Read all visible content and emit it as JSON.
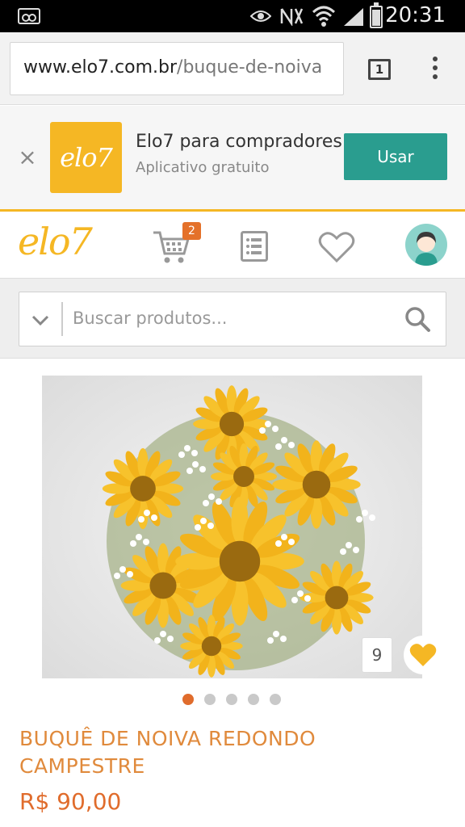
{
  "status_bar": {
    "time": "20:31",
    "icons": [
      "voicemail-icon",
      "eye-icon",
      "nfc-icon",
      "wifi-icon",
      "signal-icon",
      "battery-icon"
    ]
  },
  "browser": {
    "url_host": "www.elo7.com.br",
    "url_path": "/buque-de-noiva",
    "tab_count": "1"
  },
  "app_banner": {
    "logo_text": "elo7",
    "title": "Elo7 para compradores",
    "subtitle": "Aplicativo gratuito",
    "button_label": "Usar"
  },
  "header": {
    "logo_text": "elo7",
    "cart_count": "2"
  },
  "search": {
    "placeholder": "Buscar produtos..."
  },
  "product": {
    "favorites_count": "9",
    "title": "BUQUÊ DE NOIVA REDONDO CAMPESTRE",
    "price": "R$ 90,00",
    "carousel_total": 5,
    "carousel_active": 1
  },
  "colors": {
    "brand_yellow": "#f5b724",
    "teal": "#2a9d8f",
    "orange": "#e06c2c",
    "title_orange": "#e08a3c"
  }
}
